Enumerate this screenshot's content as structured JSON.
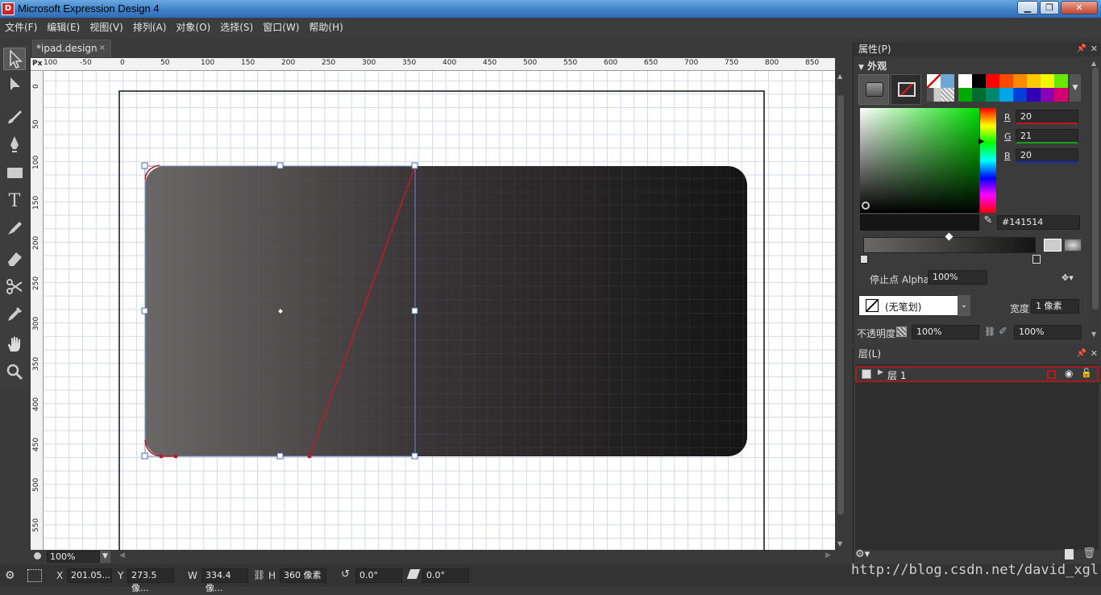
{
  "window": {
    "title": "Microsoft Expression Design 4",
    "logo_letter": "D",
    "minimize": "▁",
    "maximize": "❐",
    "close": "✕"
  },
  "menu": [
    "文件(F)",
    "编辑(E)",
    "视图(V)",
    "排列(A)",
    "对象(O)",
    "选择(S)",
    "窗口(W)",
    "帮助(H)"
  ],
  "document": {
    "tab_label": "*ipad.design",
    "tab_close": "×"
  },
  "ruler": {
    "unit": "Px",
    "h_labels": [
      "100",
      "-50",
      "0",
      "50",
      "100",
      "150",
      "200",
      "250",
      "300",
      "350",
      "400",
      "450",
      "500",
      "550",
      "600",
      "650",
      "700",
      "750",
      "800",
      "850"
    ],
    "v_labels": [
      "0",
      "50",
      "100",
      "150",
      "200",
      "250",
      "300",
      "350",
      "400",
      "450",
      "500",
      "550"
    ]
  },
  "tools": [
    "selection-arrow",
    "direct-selection",
    "brush",
    "pen",
    "rectangle",
    "text",
    "b-spline",
    "eraser",
    "scissors",
    "eyedropper",
    "hand",
    "zoom"
  ],
  "zoom": {
    "value": "100%"
  },
  "status": {
    "x_label": "X",
    "x_value": "201.05...",
    "y_label": "Y",
    "y_value": "273.5 像...",
    "w_label": "W",
    "w_value": "334.4 像...",
    "h_label": "H",
    "h_value": "360 像素",
    "rotate_value": "0.0°",
    "skew_value": "0.0°"
  },
  "properties": {
    "panel_title": "属性(P)",
    "section": "外观",
    "r_label": "R",
    "r_value": "20",
    "g_label": "G",
    "g_value": "21",
    "b_label": "B",
    "b_value": "20",
    "hex": "#141514",
    "stop_alpha_label": "停止点 Alpha",
    "stop_alpha_value": "100%",
    "stroke_value": "(无笔划)",
    "width_label": "宽度",
    "width_value": "1 像素",
    "opacity_label": "不透明度",
    "opacity_value": "100%",
    "opacity2_value": "100%",
    "swatches": [
      "#ffffff",
      "#000000",
      "#ff0000",
      "#ff4a00",
      "#ff8a00",
      "#ffc800",
      "#f5f500",
      "#66e800",
      "#00aa00",
      "#006b2e",
      "#008a6b",
      "#00a4e8",
      "#0040d8",
      "#3200b4",
      "#8a00b4",
      "#d4006e"
    ]
  },
  "layers": {
    "panel_title": "层(L)",
    "layer_name": "层 1"
  },
  "watermark": "http://blog.csdn.net/david_xgl"
}
